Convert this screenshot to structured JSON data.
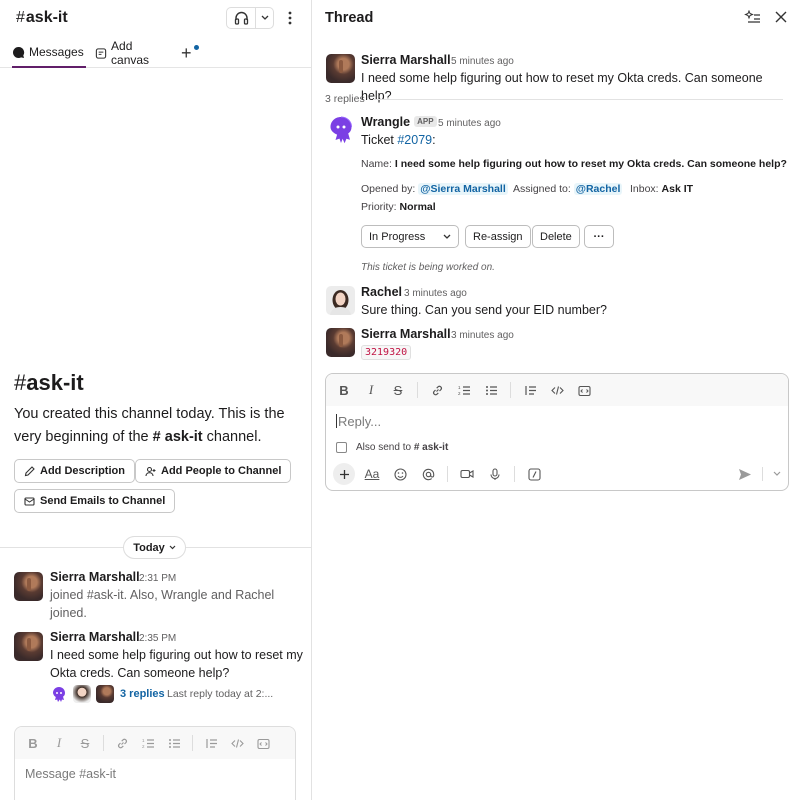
{
  "channel": {
    "hash": "#",
    "name": "ask-it"
  },
  "tabs": [
    {
      "label": "Messages",
      "active": true
    },
    {
      "label": "Add canvas",
      "active": false
    },
    {
      "label": "+"
    }
  ],
  "intro": {
    "hash": "#",
    "title": "ask-it",
    "text_before": "You created this channel today. This is the very beginning of the ",
    "channel_ref": "# ask-it",
    "text_after": " channel.",
    "buttons": {
      "add_description": "Add Description",
      "add_people": "Add People to Channel",
      "send_emails": "Send Emails to Channel"
    }
  },
  "day_divider": {
    "label": "Today"
  },
  "channel_messages": [
    {
      "author": "Sierra Marshall",
      "time": "2:31 PM",
      "text": "joined #ask-it. Also, Wrangle and Rachel joined."
    },
    {
      "author": "Sierra Marshall",
      "time": "2:35 PM",
      "text": "I need some help figuring out how to reset my Okta creds. Can someone help?",
      "replies_label": "3 replies",
      "last_reply": "Last reply today at 2:..."
    }
  ],
  "left_composer": {
    "placeholder": "Message #ask-it"
  },
  "thread": {
    "title": "Thread",
    "parent": {
      "author": "Sierra Marshall",
      "time": "5 minutes ago",
      "text": "I need some help figuring out how to reset my Okta creds. Can someone help?"
    },
    "replies_count": "3 replies",
    "wrangle": {
      "author": "Wrangle",
      "badge": "APP",
      "time": "5 minutes ago",
      "ticket_prefix": "Ticket ",
      "ticket_link": "#2079",
      "ticket_suffix": ":",
      "name_label": "Name:",
      "name_value": "I need some help figuring out how to reset my Okta creds. Can someone help?",
      "opened_label": "Opened by:",
      "opened_value": "@Sierra Marshall",
      "assigned_label": "Assigned to:",
      "assigned_value": "@Rachel",
      "inbox_label": "Inbox:",
      "inbox_value": "Ask IT",
      "priority_label": "Priority:",
      "priority_value": "Normal",
      "status_select": "In Progress",
      "reassign_label": "Re-assign",
      "delete_label": "Delete",
      "more_label": "···",
      "status_note": "This ticket is being worked on."
    },
    "rachel": {
      "author": "Rachel",
      "time": "3 minutes ago",
      "text": "Sure thing. Can you send your EID number?"
    },
    "sierra_reply": {
      "author": "Sierra Marshall",
      "time": "3 minutes ago",
      "code": "3219320"
    },
    "composer": {
      "placeholder": "Reply...",
      "also_send": "Also send to",
      "also_send_channel": "# ask-it"
    }
  },
  "colors": {
    "accent": "#611f69",
    "link": "#1264a3",
    "code": "#c01343"
  }
}
